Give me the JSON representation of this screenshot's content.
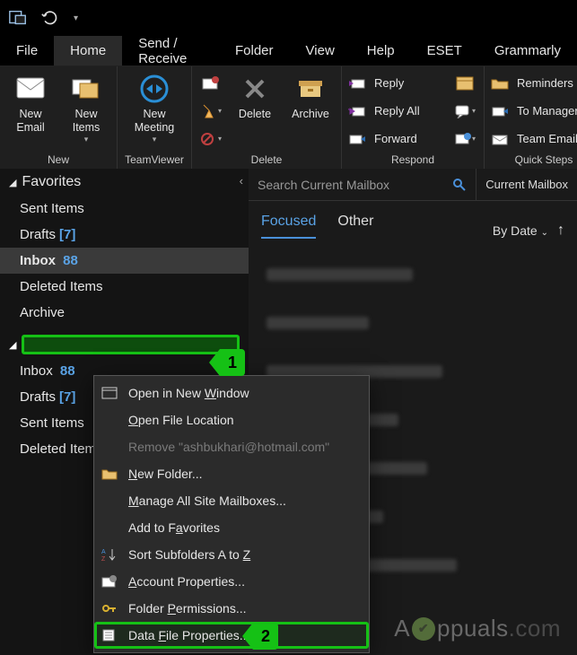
{
  "tabs": {
    "file": "File",
    "home": "Home",
    "sendreceive": "Send / Receive",
    "folder": "Folder",
    "view": "View",
    "help": "Help",
    "eset": "ESET",
    "grammarly": "Grammarly"
  },
  "ribbon": {
    "new": {
      "label": "New",
      "newEmail": "New\nEmail",
      "newItems": "New\nItems"
    },
    "teamviewer": {
      "label": "TeamViewer",
      "newMeeting": "New\nMeeting"
    },
    "delete": {
      "label": "Delete",
      "delete": "Delete",
      "archive": "Archive"
    },
    "respond": {
      "label": "Respond",
      "reply": "Reply",
      "replyAll": "Reply All",
      "forward": "Forward"
    },
    "quicksteps": {
      "label": "Quick Steps",
      "reminders": "Reminders",
      "toManager": "To Manager",
      "teamEmail": "Team Email"
    }
  },
  "nav": {
    "favorites": "Favorites",
    "favItems": {
      "sent": "Sent Items",
      "drafts": "Drafts",
      "draftsCount": "[7]",
      "inbox": "Inbox",
      "inboxCount": "88",
      "deleted": "Deleted Items",
      "archive": "Archive"
    },
    "acctItems": {
      "inbox": "Inbox",
      "inboxCount": "88",
      "drafts": "Drafts",
      "draftsCount": "[7]",
      "sent": "Sent Items",
      "deleted": "Deleted Items"
    }
  },
  "search": {
    "placeholder": "Search Current Mailbox",
    "scope": "Current Mailbox"
  },
  "msgtabs": {
    "focused": "Focused",
    "other": "Other"
  },
  "sort": {
    "byDate": "By Date"
  },
  "ctx": {
    "openNewWindow": {
      "pre": "Open in New ",
      "u": "W",
      "post": "indow"
    },
    "openFileLoc": {
      "u": "O",
      "post": "pen File Location"
    },
    "remove": "Remove \"ashbukhari@hotmail.com\"",
    "newFolder": {
      "u": "N",
      "post": "ew Folder..."
    },
    "manageMbx": {
      "u": "M",
      "post": "anage All Site Mailboxes..."
    },
    "addFav": {
      "pre": "Add to F",
      "u": "a",
      "post": "vorites"
    },
    "sortSub": {
      "pre": "Sort Subfolders A to ",
      "u": "Z"
    },
    "acctProps": {
      "u": "A",
      "post": "ccount Properties..."
    },
    "folderPerm": {
      "pre": "Folder ",
      "u": "P",
      "post": "ermissions..."
    },
    "dataFile": {
      "pre": "Data ",
      "u": "F",
      "post": "ile Properties..."
    }
  },
  "callouts": {
    "one": "1",
    "two": "2"
  },
  "watermark": {
    "pre": "A",
    "mid": "ppuals",
    "post": ".com"
  }
}
